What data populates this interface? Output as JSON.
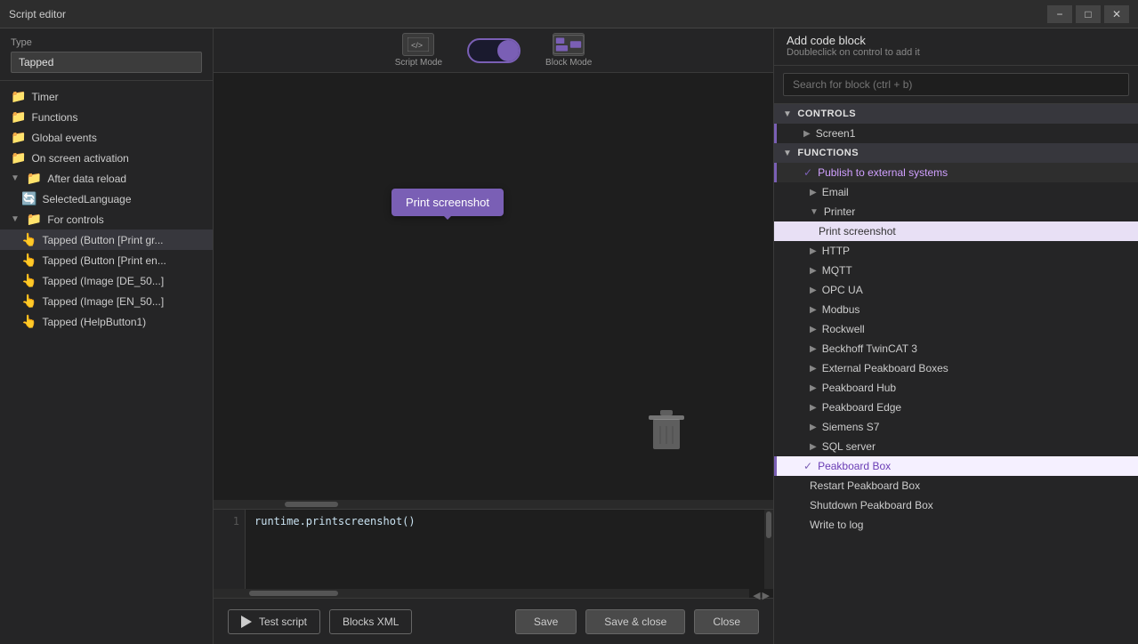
{
  "titleBar": {
    "title": "Script editor"
  },
  "typeSection": {
    "label": "Type",
    "value": "Tapped"
  },
  "tree": {
    "items": [
      {
        "label": "Timer",
        "icon": "📁",
        "indent": 0
      },
      {
        "label": "Functions",
        "icon": "📁",
        "indent": 0
      },
      {
        "label": "Global events",
        "icon": "📁",
        "indent": 0
      },
      {
        "label": "On screen activation",
        "icon": "📁",
        "indent": 0
      },
      {
        "label": "After data reload",
        "icon": "📁",
        "indent": 0,
        "expanded": true
      },
      {
        "label": "SelectedLanguage",
        "icon": "🔄",
        "indent": 1
      },
      {
        "label": "For controls",
        "icon": "📁",
        "indent": 0,
        "expanded": true
      },
      {
        "label": "Tapped (Button [Print gr...",
        "icon": "👆",
        "indent": 1
      },
      {
        "label": "Tapped (Button [Print en...",
        "icon": "👆",
        "indent": 1
      },
      {
        "label": "Tapped (Image [DE_50...]",
        "icon": "👆",
        "indent": 1
      },
      {
        "label": "Tapped (Image [EN_50...]",
        "icon": "👆",
        "indent": 1
      },
      {
        "label": "Tapped (HelpButton1)",
        "icon": "👆",
        "indent": 1
      }
    ]
  },
  "toolbar": {
    "scriptMode": "Script Mode",
    "blockMode": "Block Mode",
    "toggleOn": true
  },
  "canvas": {
    "printTooltip": "Print screenshot"
  },
  "codeEditor": {
    "lineNumber": "1",
    "code": "runtime.printscreenshot()"
  },
  "bottomBar": {
    "testScript": "Test script",
    "blocksXml": "Blocks XML",
    "save": "Save",
    "saveClose": "Save & close",
    "close": "Close"
  },
  "rightPanel": {
    "addCodeBlock": {
      "title": "Add code block",
      "subtitle": "Doubleclick on control to add it"
    },
    "searchPlaceholder": "Search for block (ctrl + b)",
    "sections": {
      "controls": "CONTROLS",
      "functions": "FUNCTIONS"
    },
    "items": [
      {
        "label": "Screen1",
        "indent": 1,
        "type": "normal"
      },
      {
        "label": "Publish to external systems",
        "indent": 1,
        "type": "publish",
        "hasCheck": true
      },
      {
        "label": "Email",
        "indent": 2,
        "type": "normal"
      },
      {
        "label": "Printer",
        "indent": 2,
        "type": "normal",
        "expanded": true
      },
      {
        "label": "Print screenshot",
        "indent": 3,
        "type": "printer-print"
      },
      {
        "label": "HTTP",
        "indent": 2,
        "type": "normal"
      },
      {
        "label": "MQTT",
        "indent": 2,
        "type": "normal"
      },
      {
        "label": "OPC UA",
        "indent": 2,
        "type": "normal"
      },
      {
        "label": "Modbus",
        "indent": 2,
        "type": "normal"
      },
      {
        "label": "Rockwell",
        "indent": 2,
        "type": "normal"
      },
      {
        "label": "Beckhoff TwinCAT 3",
        "indent": 2,
        "type": "normal"
      },
      {
        "label": "External Peakboard Boxes",
        "indent": 2,
        "type": "normal"
      },
      {
        "label": "Peakboard Hub",
        "indent": 2,
        "type": "normal"
      },
      {
        "label": "Peakboard Edge",
        "indent": 2,
        "type": "normal"
      },
      {
        "label": "Siemens S7",
        "indent": 2,
        "type": "normal"
      },
      {
        "label": "SQL server",
        "indent": 2,
        "type": "normal"
      },
      {
        "label": "Peakboard Box",
        "indent": 1,
        "type": "peakboard-box",
        "hasCheck": true
      },
      {
        "label": "Restart Peakboard Box",
        "indent": 2,
        "type": "normal"
      },
      {
        "label": "Shutdown Peakboard Box",
        "indent": 2,
        "type": "normal"
      },
      {
        "label": "Write to log",
        "indent": 2,
        "type": "normal"
      }
    ]
  }
}
